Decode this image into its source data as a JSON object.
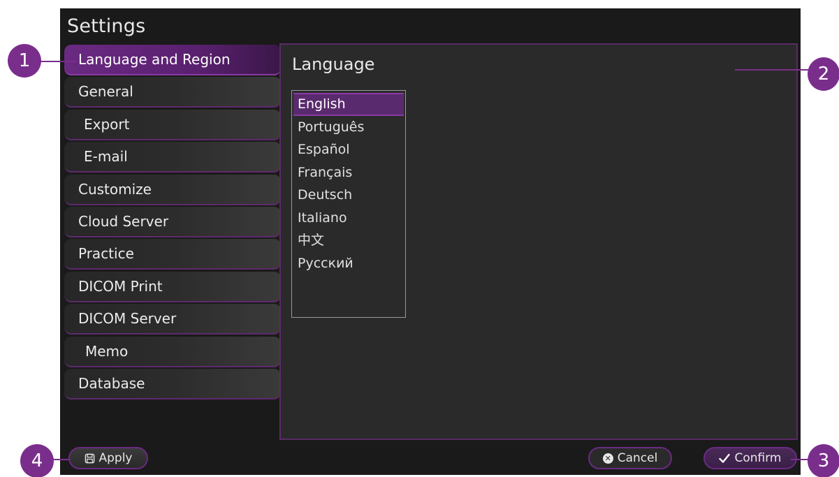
{
  "window": {
    "title": "Settings"
  },
  "sidebar": {
    "items": [
      {
        "label": "Language and Region",
        "active": true
      },
      {
        "label": "General"
      },
      {
        "label": "Export"
      },
      {
        "label": "E-mail"
      },
      {
        "label": "Customize"
      },
      {
        "label": "Cloud Server"
      },
      {
        "label": "Practice"
      },
      {
        "label": "DICOM Print"
      },
      {
        "label": "DICOM Server"
      },
      {
        "label": "Memo"
      },
      {
        "label": "Database"
      }
    ]
  },
  "content": {
    "title": "Language",
    "languages": [
      "English",
      "Português",
      "Español",
      "Français",
      "Deutsch",
      "Italiano",
      "中文",
      "Русский"
    ],
    "selected": "English"
  },
  "buttons": {
    "apply": "Apply",
    "cancel": "Cancel",
    "confirm": "Confirm"
  },
  "callouts": {
    "c1": "1",
    "c2": "2",
    "c3": "3",
    "c4": "4"
  },
  "colors": {
    "accent": "#7a2e8c",
    "background": "#1a1a1a",
    "panel": "#2a2a2a"
  }
}
